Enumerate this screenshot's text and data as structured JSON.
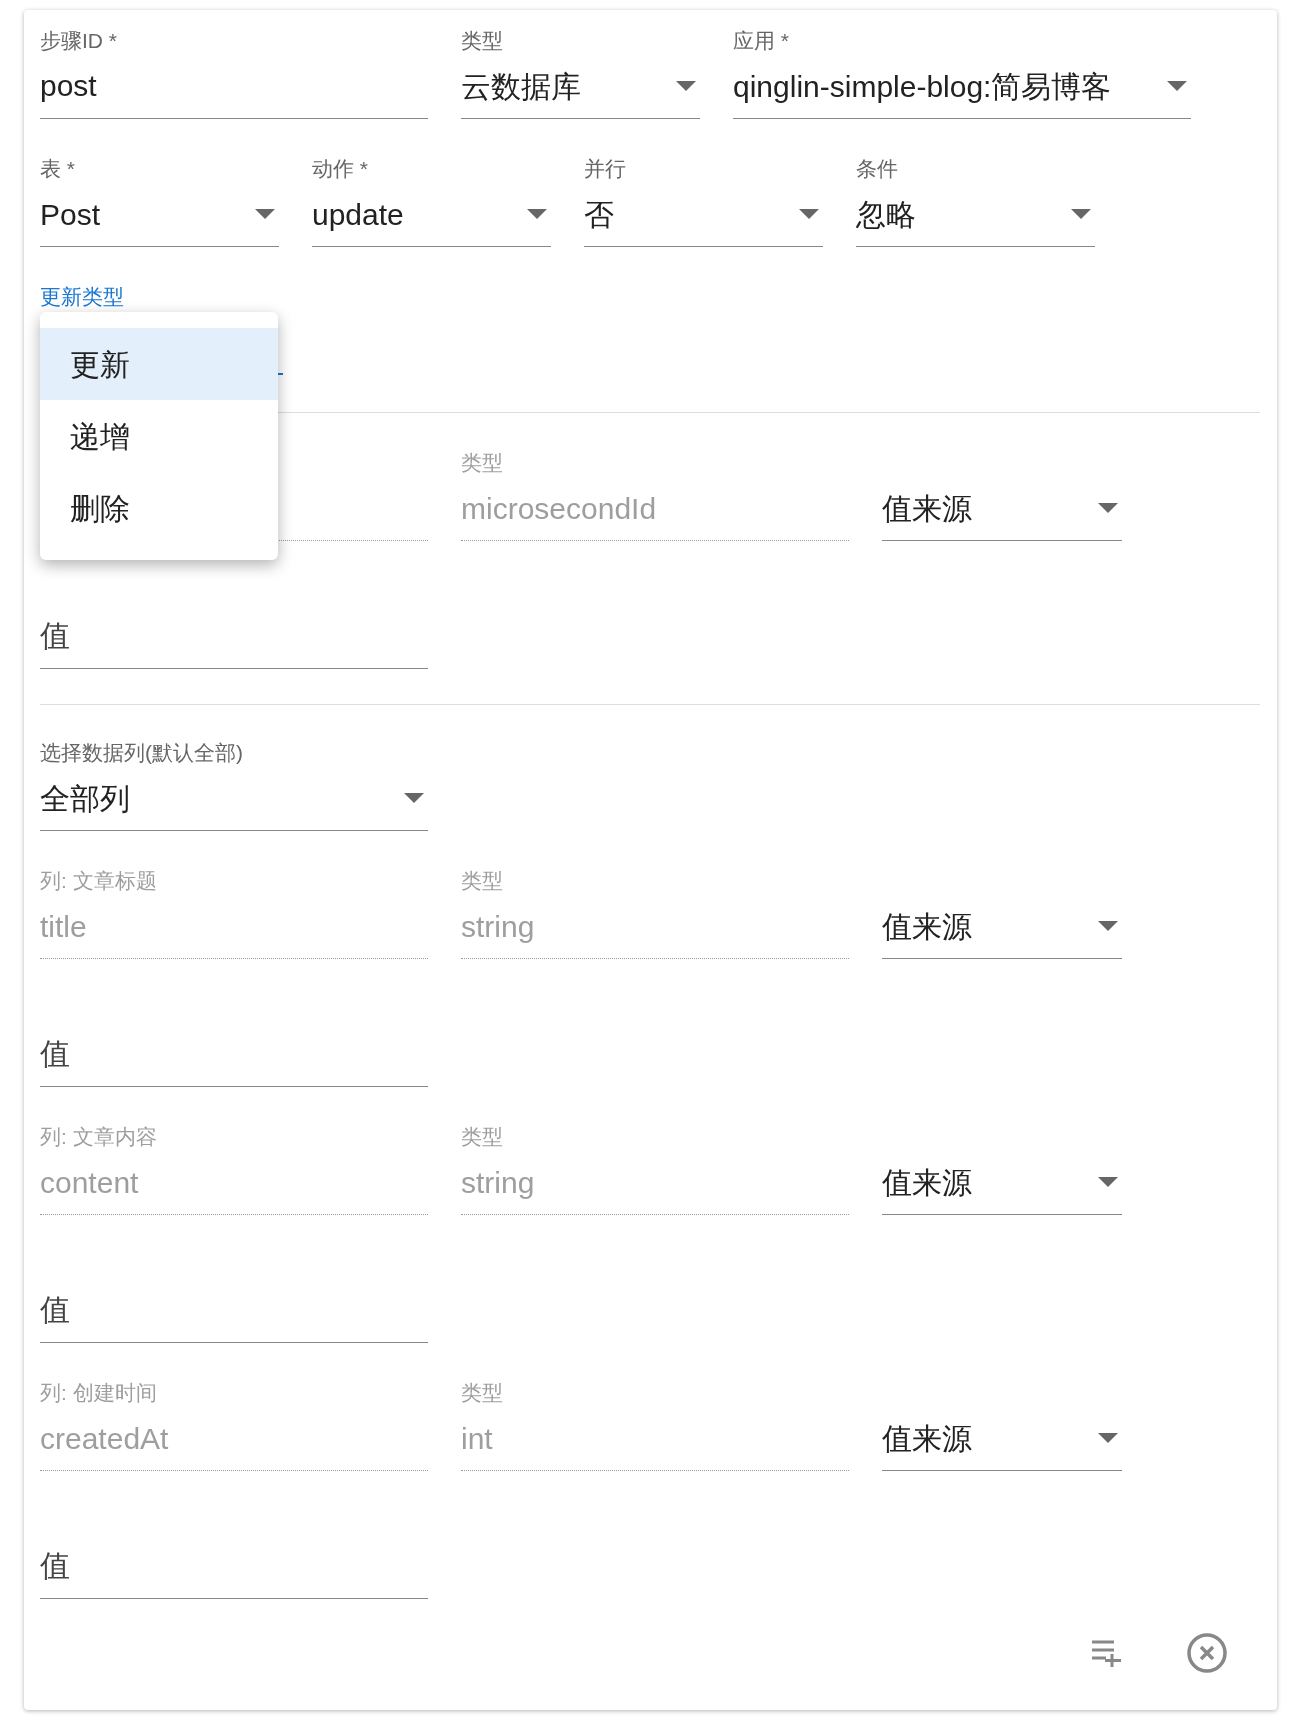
{
  "step_fields": [
    {
      "kind": "text",
      "label": "步骤ID *",
      "value": "post"
    },
    {
      "kind": "select",
      "label": "类型",
      "value": "云数据库"
    },
    {
      "kind": "select",
      "label": "应用 *",
      "value": "qinglin-simple-blog:简易博客"
    }
  ],
  "option_fields": [
    {
      "label": "表 *",
      "value": "Post"
    },
    {
      "label": "动作 *",
      "value": "update"
    },
    {
      "label": "并行",
      "value": "否"
    },
    {
      "label": "条件",
      "value": "忽略"
    }
  ],
  "update_type": {
    "label": "更新类型",
    "menu": [
      {
        "label": "更新",
        "selected": true
      },
      {
        "label": "递增",
        "selected": false
      },
      {
        "label": "删除",
        "selected": false
      }
    ]
  },
  "id_column": {
    "type_label": "类型",
    "type_value": "microsecondId",
    "source": "值来源",
    "value_placeholder": "值"
  },
  "column_select": {
    "label": "选择数据列(默认全部)",
    "value": "全部列"
  },
  "columns": [
    {
      "name_label": "列: 文章标题",
      "name": "title",
      "type_label": "类型",
      "type_value": "string",
      "source": "值来源",
      "value_placeholder": "值"
    },
    {
      "name_label": "列: 文章内容",
      "name": "content",
      "type_label": "类型",
      "type_value": "string",
      "source": "值来源",
      "value_placeholder": "值"
    },
    {
      "name_label": "列: 创建时间",
      "name": "createdAt",
      "type_label": "类型",
      "type_value": "int",
      "source": "值来源",
      "value_placeholder": "值"
    }
  ]
}
